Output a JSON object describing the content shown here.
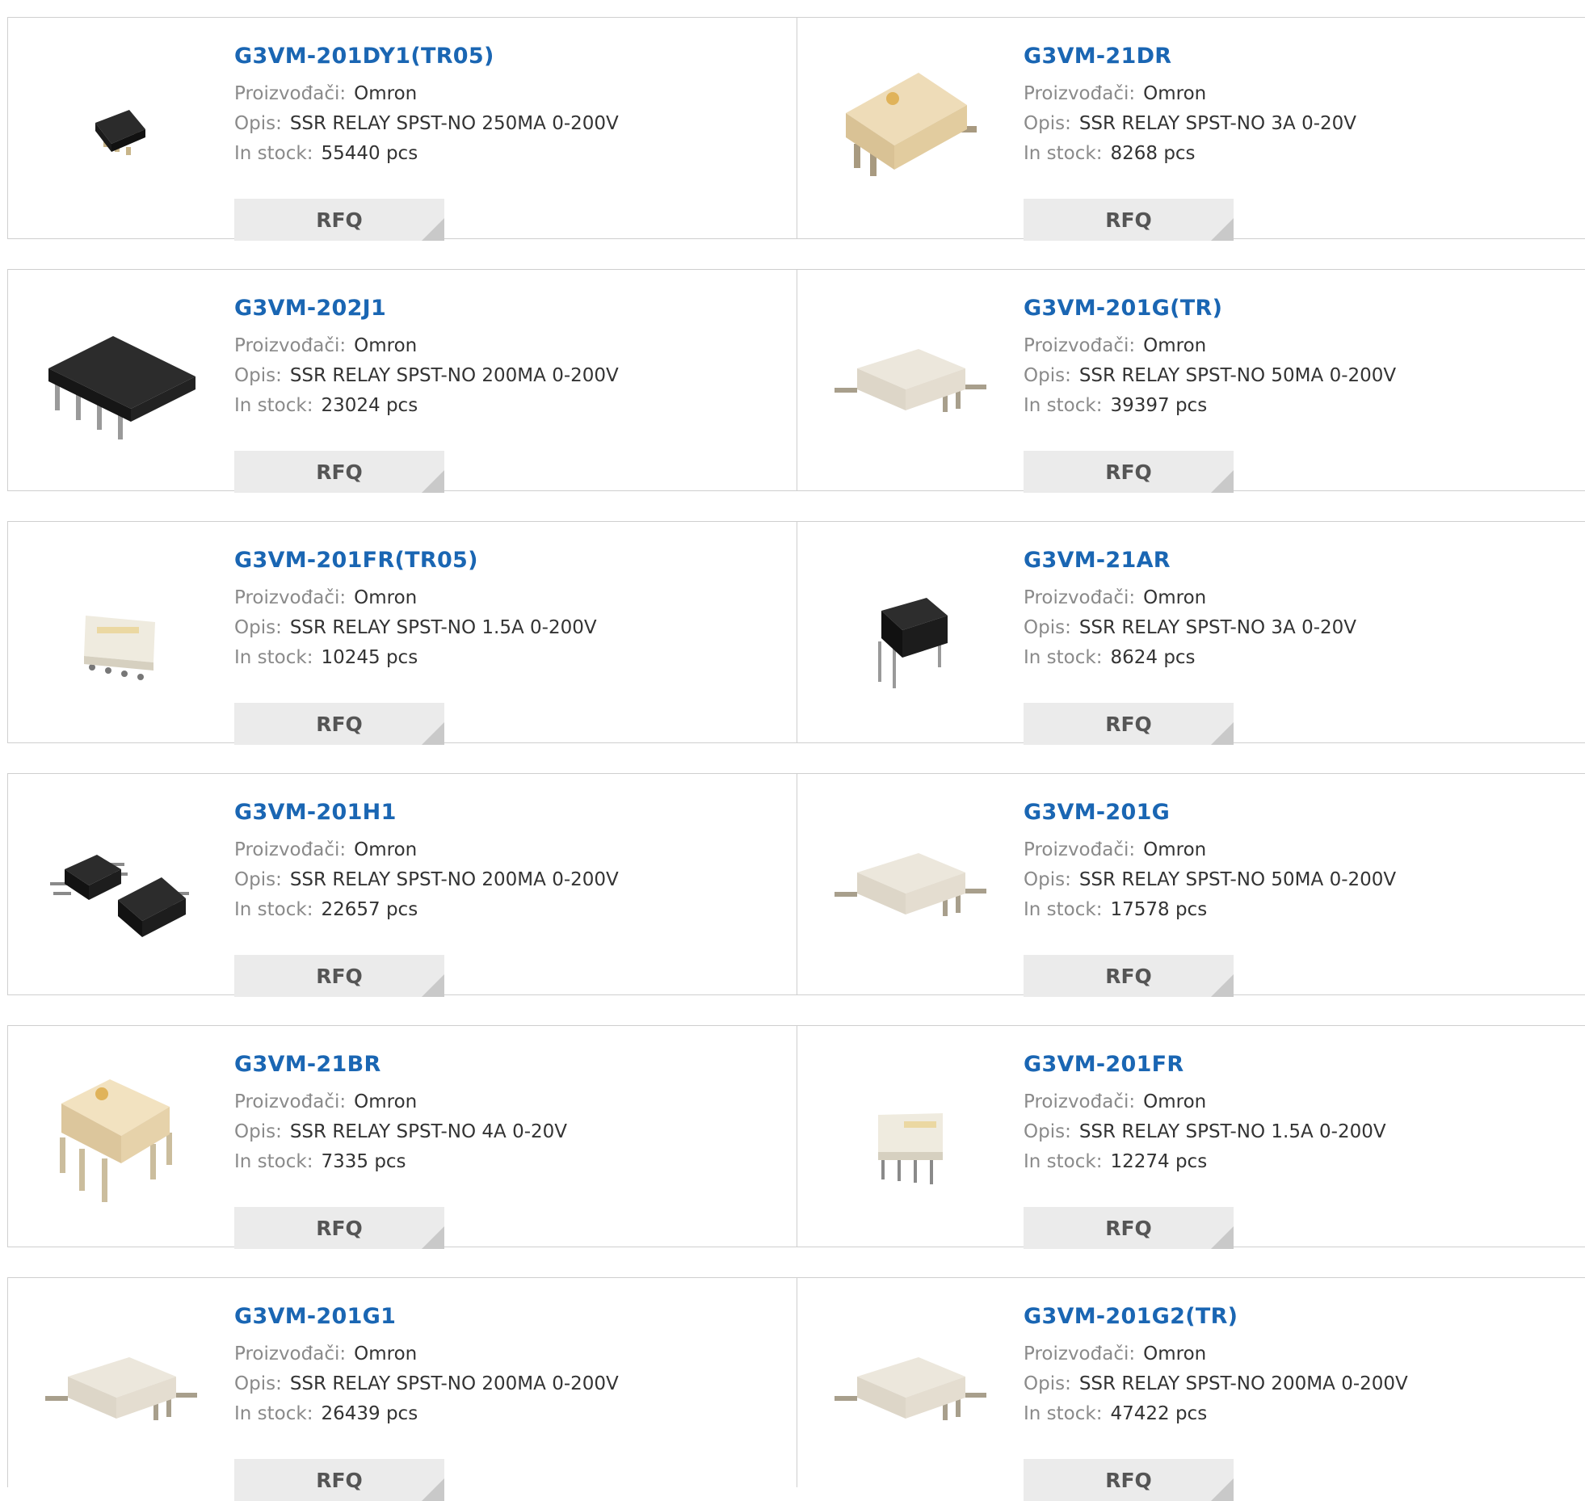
{
  "labels": {
    "manufacturer": "Proizvođači:",
    "description": "Opis:",
    "stock": "In stock:",
    "rfq": "RFQ"
  },
  "colors": {
    "link": "#1a66b3",
    "label": "#8a8a8a",
    "value": "#333333",
    "button": "#ebebeb"
  },
  "products": [
    {
      "part": "G3VM-201DY1(TR05)",
      "manufacturer": "Omron",
      "description": "SSR RELAY SPST-NO 250MA 0-200V",
      "stock": "55440 pcs",
      "image": "small-black-4pin-smd-chip"
    },
    {
      "part": "G3VM-21DR",
      "manufacturer": "Omron",
      "description": "SSR RELAY SPST-NO 3A 0-20V",
      "stock": "8268 pcs",
      "image": "beige-4pin-smd-relay"
    },
    {
      "part": "G3VM-202J1",
      "manufacturer": "Omron",
      "description": "SSR RELAY SPST-NO 200MA 0-200V",
      "stock": "23024 pcs",
      "image": "black-8pin-smd-relay"
    },
    {
      "part": "G3VM-201G(TR)",
      "manufacturer": "Omron",
      "description": "SSR RELAY SPST-NO 50MA 0-200V",
      "stock": "39397 pcs",
      "image": "beige-smd-relay"
    },
    {
      "part": "G3VM-201FR(TR05)",
      "manufacturer": "Omron",
      "description": "SSR RELAY SPST-NO 1.5A 0-200V",
      "stock": "10245 pcs",
      "image": "white-omron-8pin-smd-relay"
    },
    {
      "part": "G3VM-21AR",
      "manufacturer": "Omron",
      "description": "SSR RELAY SPST-NO 3A 0-20V",
      "stock": "8624 pcs",
      "image": "black-4pin-dip-relay"
    },
    {
      "part": "G3VM-201H1",
      "manufacturer": "Omron",
      "description": "SSR RELAY SPST-NO 200MA 0-200V",
      "stock": "22657 pcs",
      "image": "two-black-smd-relays"
    },
    {
      "part": "G3VM-201G",
      "manufacturer": "Omron",
      "description": "SSR RELAY SPST-NO 50MA 0-200V",
      "stock": "17578 pcs",
      "image": "beige-smd-relay"
    },
    {
      "part": "G3VM-21BR",
      "manufacturer": "Omron",
      "description": "SSR RELAY SPST-NO 4A 0-20V",
      "stock": "7335 pcs",
      "image": "beige-6pin-dip-relay"
    },
    {
      "part": "G3VM-201FR",
      "manufacturer": "Omron",
      "description": "SSR RELAY SPST-NO 1.5A 0-200V",
      "stock": "12274 pcs",
      "image": "white-omron-8pin-dip-relay"
    },
    {
      "part": "G3VM-201G1",
      "manufacturer": "Omron",
      "description": "SSR RELAY SPST-NO 200MA 0-200V",
      "stock": "26439 pcs",
      "image": "beige-smd-relay"
    },
    {
      "part": "G3VM-201G2(TR)",
      "manufacturer": "Omron",
      "description": "SSR RELAY SPST-NO 200MA 0-200V",
      "stock": "47422 pcs",
      "image": "beige-smd-relay"
    }
  ]
}
